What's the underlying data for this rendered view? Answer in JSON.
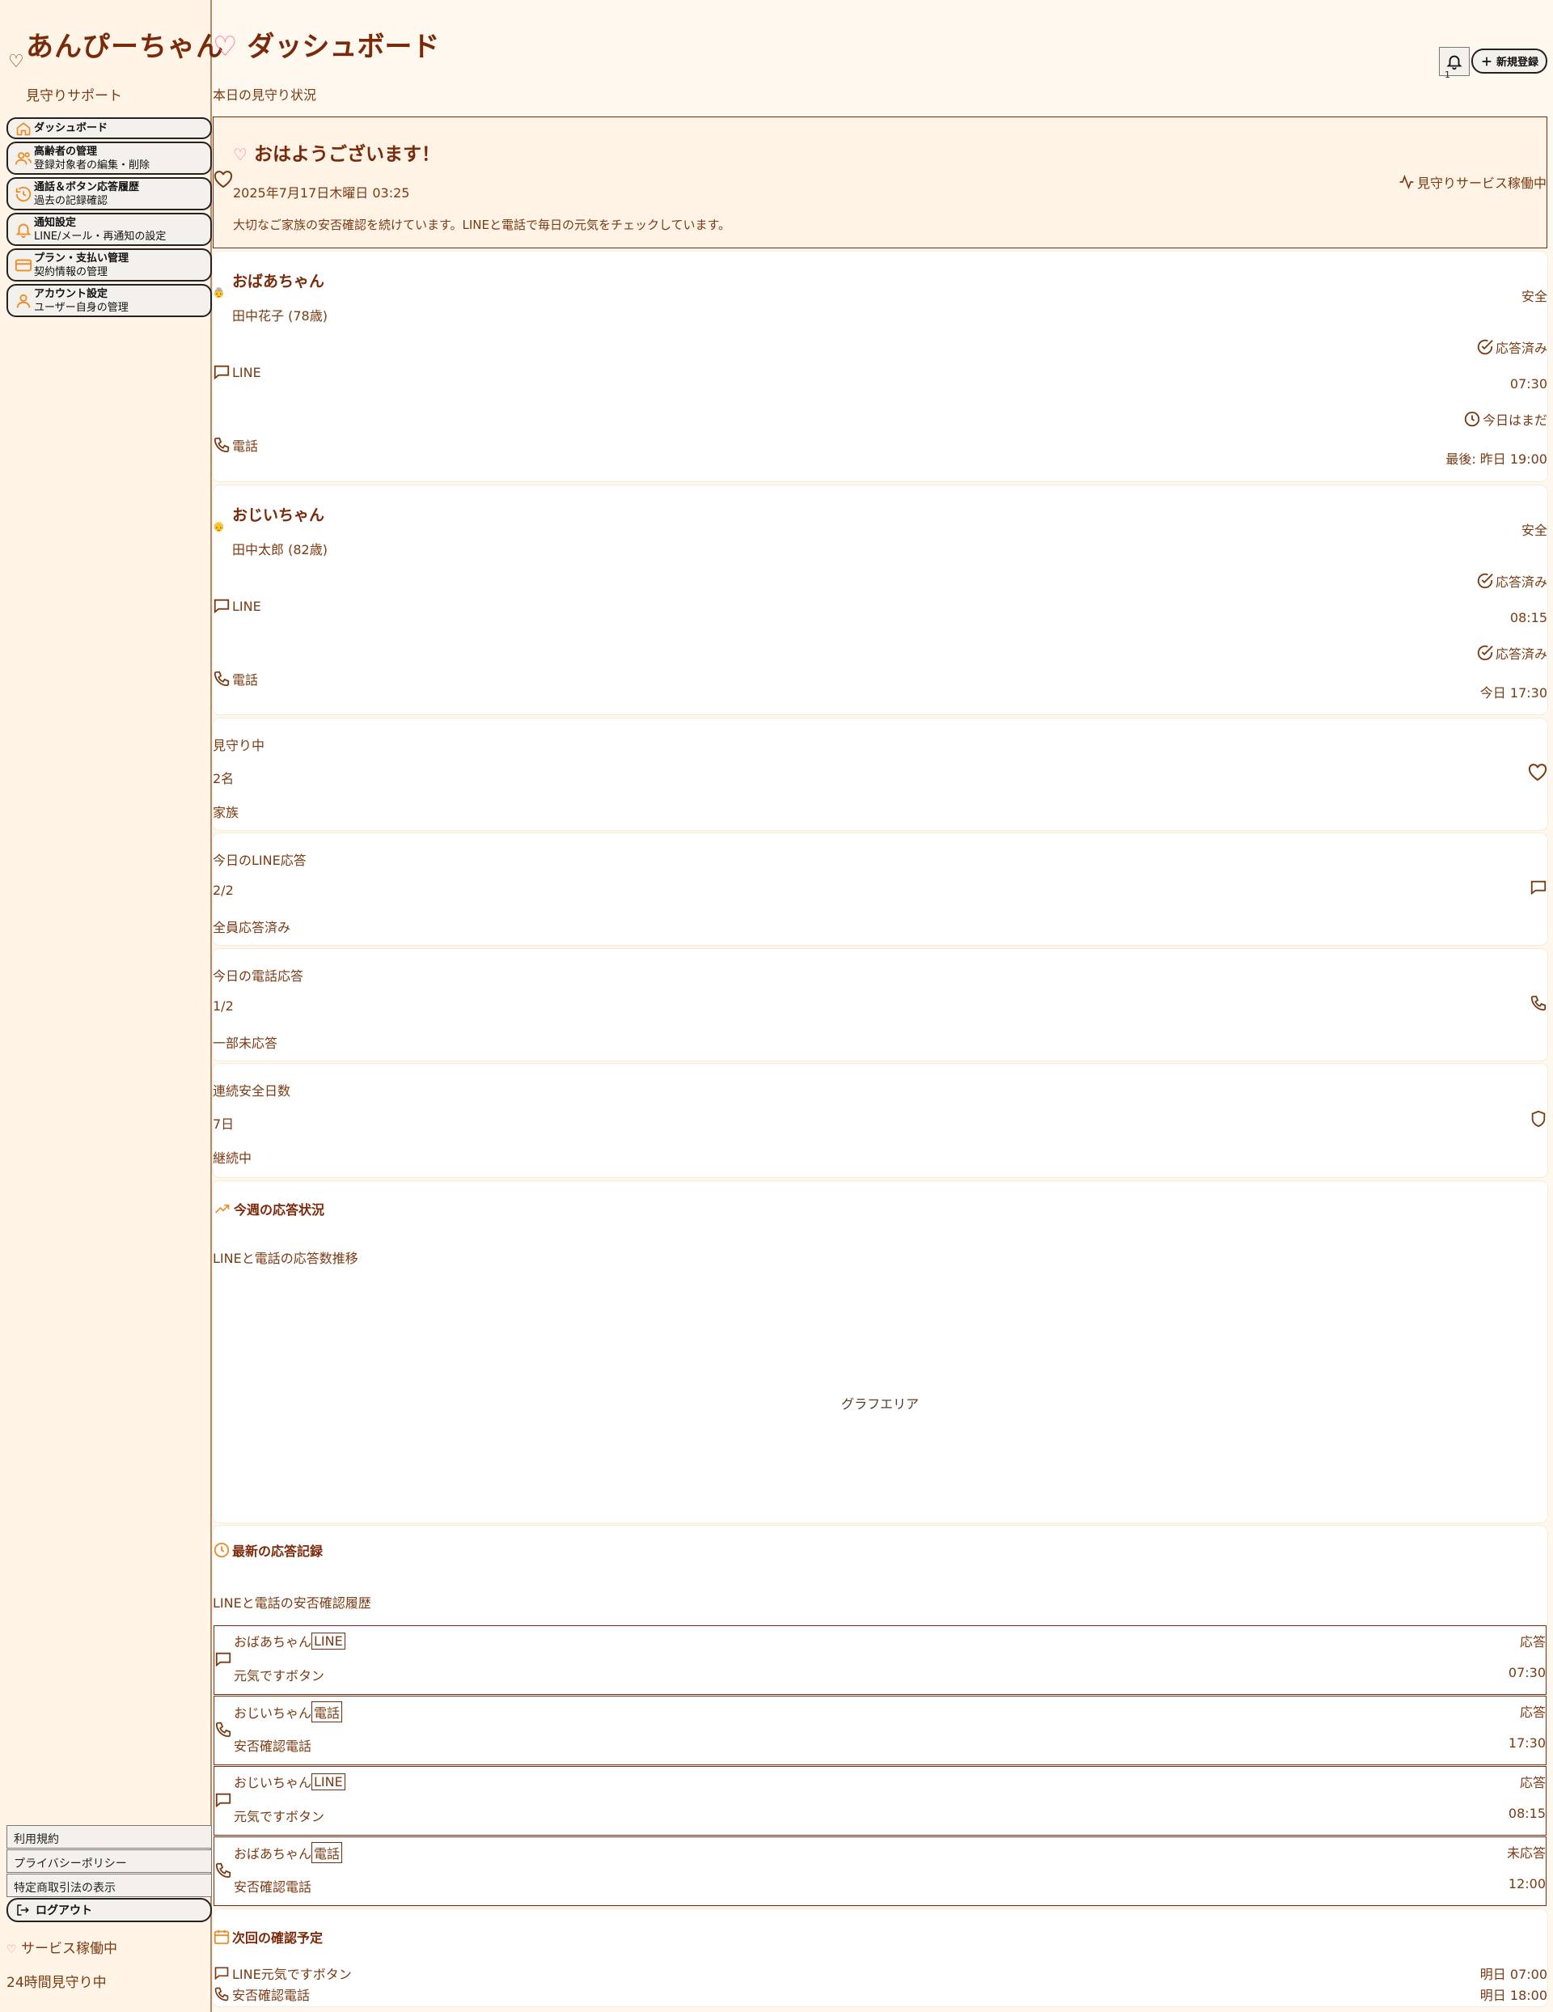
{
  "sidebar": {
    "brand": "あんぴーちゃん",
    "subtitle": "見守りサポート",
    "nav": [
      {
        "label": "ダッシュボード",
        "sub": ""
      },
      {
        "label": "高齢者の管理",
        "sub": "登録対象者の編集・削除"
      },
      {
        "label": "通話＆ボタン応答履歴",
        "sub": "過去の記録確認"
      },
      {
        "label": "通知設定",
        "sub": "LINE/メール・再通知の設定"
      },
      {
        "label": "プラン・支払い管理",
        "sub": "契約情報の管理"
      },
      {
        "label": "アカウント設定",
        "sub": "ユーザー自身の管理"
      }
    ],
    "footer_links": [
      "利用規約",
      "プライバシーポリシー",
      "特定商取引法の表示"
    ],
    "logout": "ログアウト",
    "service_status": "サービス稼働中",
    "service_hours": "24時間見守り中"
  },
  "header": {
    "title_heart": "♡",
    "title": "ダッシュボード",
    "subtitle": "本日の見守り状況",
    "notification_count": "1",
    "new_button": "新規登録"
  },
  "welcome": {
    "heart": "♡",
    "title": "おはようございます！",
    "date": "2025年7月17日木曜日 03:25",
    "message": "大切なご家族の安否確認を続けています。LINEと電話で毎日の元気をチェックしています。",
    "status": "見守りサービス稼働中"
  },
  "family": [
    {
      "nickname": "おばあちゃん",
      "name": "田中花子 (78歳)",
      "state": "安全",
      "line_label": "LINE",
      "line_status": "応答済み",
      "line_time": "07:30",
      "phone_label": "電話",
      "phone_status": "今日はまだ",
      "phone_time": "最後: 昨日 19:00"
    },
    {
      "nickname": "おじいちゃん",
      "name": "田中太郎 (82歳)",
      "state": "安全",
      "line_label": "LINE",
      "line_status": "応答済み",
      "line_time": "08:15",
      "phone_label": "電話",
      "phone_status": "応答済み",
      "phone_time": "今日 17:30"
    }
  ],
  "stats": [
    {
      "label": "見守り中",
      "value": "2名",
      "note": "家族",
      "icon": "heart-icon"
    },
    {
      "label": "今日のLINE応答",
      "value": "2/2",
      "note": "全員応答済み",
      "icon": "message-icon"
    },
    {
      "label": "今日の電話応答",
      "value": "1/2",
      "note": "一部未応答",
      "icon": "phone-icon"
    },
    {
      "label": "連続安全日数",
      "value": "7日",
      "note": "継続中",
      "icon": "shield-icon"
    }
  ],
  "weekly": {
    "title": "今週の応答状況",
    "subtitle": "LINEと電話の応答数推移",
    "placeholder": "グラフエリア"
  },
  "recent": {
    "title": "最新の応答記録",
    "subtitle": "LINEと電話の安否確認履歴",
    "records": [
      {
        "who": "おばあちゃん",
        "channel": "LINE",
        "what": "元気ですボタン",
        "result": "応答",
        "time": "07:30"
      },
      {
        "who": "おじいちゃん",
        "channel": "電話",
        "what": "安否確認電話",
        "result": "応答",
        "time": "17:30"
      },
      {
        "who": "おじいちゃん",
        "channel": "LINE",
        "what": "元気ですボタン",
        "result": "応答",
        "time": "08:15"
      },
      {
        "who": "おばあちゃん",
        "channel": "電話",
        "what": "安否確認電話",
        "result": "未応答",
        "time": "12:00"
      }
    ]
  },
  "schedule": {
    "title": "次回の確認予定",
    "items": [
      {
        "label": "LINE元気ですボタン",
        "time": "明日 07:00"
      },
      {
        "label": "安否確認電話",
        "time": "明日 18:00"
      }
    ]
  },
  "colors": {
    "brand": "#7a2a0a",
    "accent": "#f08a24",
    "heart": "#ff6fa0",
    "background": "#fff8ef"
  }
}
